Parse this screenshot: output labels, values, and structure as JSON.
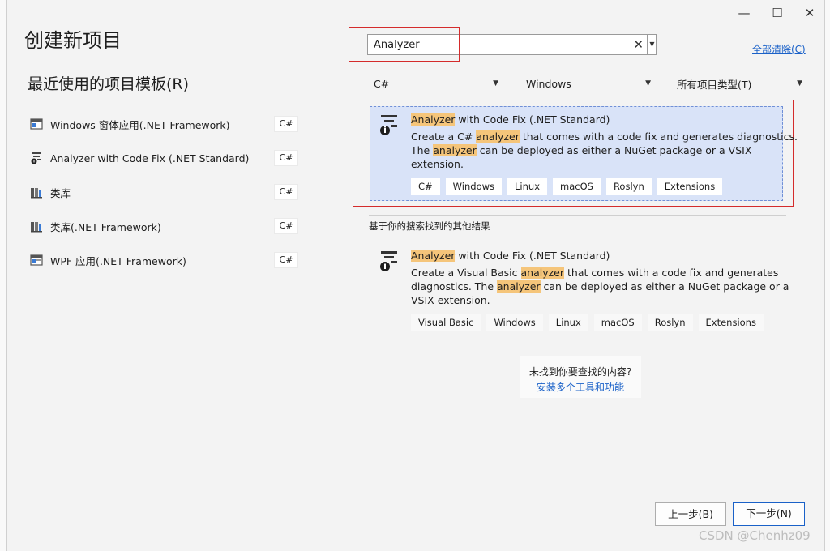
{
  "window": {
    "title": "创建新项目",
    "minimize_glyph": "—",
    "maximize_glyph": "☐",
    "close_glyph": "✕"
  },
  "recent": {
    "heading": "最近使用的项目模板(R)",
    "items": [
      {
        "label": "Windows 窗体应用(.NET Framework)",
        "tag": "C#",
        "icon": "winforms-icon"
      },
      {
        "label": "Analyzer with Code Fix (.NET Standard)",
        "tag": "C#",
        "icon": "analyzer-icon"
      },
      {
        "label": "类库",
        "tag": "C#",
        "icon": "class-library-icon"
      },
      {
        "label": "类库(.NET Framework)",
        "tag": "C#",
        "icon": "class-library-icon"
      },
      {
        "label": "WPF 应用(.NET Framework)",
        "tag": "C#",
        "icon": "wpf-icon"
      }
    ]
  },
  "search": {
    "value": "Analyzer",
    "clear_glyph": "✕",
    "clear_all": "全部清除(C)"
  },
  "filters": {
    "language": "C#",
    "platform": "Windows",
    "project_type": "所有项目类型(T)"
  },
  "results": {
    "selected": {
      "title_hl": "Analyzer",
      "title_rest": " with Code Fix (.NET Standard)",
      "desc_1a": "Create a C# ",
      "desc_1b": "analyzer",
      "desc_1c": " that comes with a code fix and generates diagnostics.",
      "desc_2a": "The ",
      "desc_2b": "analyzer",
      "desc_2c": " can be deployed as either a NuGet package or a VSIX",
      "desc_3": "extension.",
      "tags": [
        "C#",
        "Windows",
        "Linux",
        "macOS",
        "Roslyn",
        "Extensions"
      ]
    },
    "other_heading": "基于你的搜索找到的其他结果",
    "other": {
      "title_hl": "Analyzer",
      "title_rest": " with Code Fix (.NET Standard)",
      "desc_1a": "Create a Visual Basic ",
      "desc_1b": "analyzer",
      "desc_1c": " that comes with a code fix and generates",
      "desc_2a": "diagnostics. The ",
      "desc_2b": "analyzer",
      "desc_2c": " can be deployed as either a NuGet package or a",
      "desc_3": "VSIX extension.",
      "tags": [
        "Visual Basic",
        "Windows",
        "Linux",
        "macOS",
        "Roslyn",
        "Extensions"
      ]
    },
    "not_found": "未找到你要查找的内容?",
    "install_link": "安装多个工具和功能"
  },
  "buttons": {
    "back": "上一步(B)",
    "next": "下一步(N)"
  },
  "watermark": "CSDN @Chenhz09",
  "colors": {
    "accent": "#1a61c8",
    "highlight": "#f5c57a",
    "selection": "#d9e3f8",
    "annotation_red": "#d42b2b"
  }
}
